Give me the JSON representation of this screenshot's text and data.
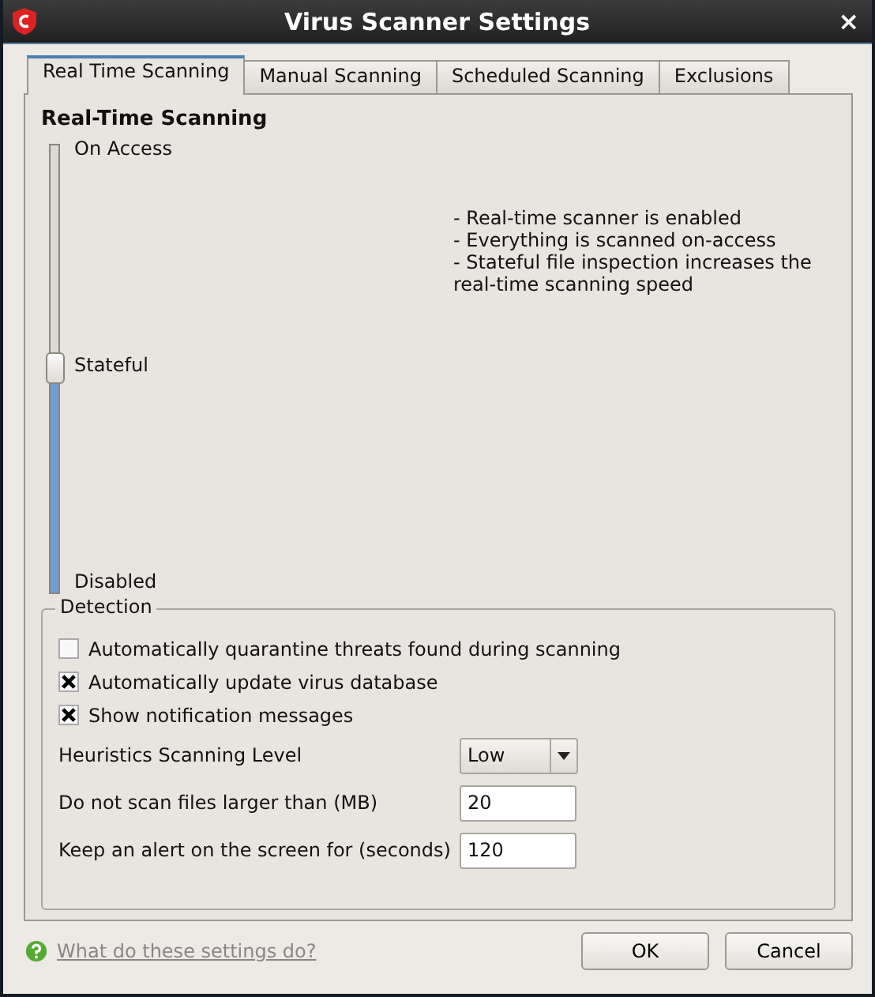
{
  "window": {
    "title": "Virus Scanner Settings",
    "close": "×"
  },
  "tabs": [
    {
      "label": "Real Time Scanning",
      "selected": true
    },
    {
      "label": "Manual Scanning",
      "selected": false
    },
    {
      "label": "Scheduled Scanning",
      "selected": false
    },
    {
      "label": "Exclusions",
      "selected": false
    }
  ],
  "section_title": "Real-Time Scanning",
  "slider": {
    "level": 0.5,
    "labels": [
      "On Access",
      "Stateful",
      "Disabled"
    ]
  },
  "description": [
    "- Real-time scanner is enabled",
    "- Everything is scanned on-access",
    "- Stateful file inspection increases the real-time scanning speed"
  ],
  "detection": {
    "title": "Detection",
    "checkboxes": [
      {
        "label": "Automatically quarantine threats found during scanning",
        "checked": false
      },
      {
        "label": "Automatically update virus database",
        "checked": true
      },
      {
        "label": "Show notification messages",
        "checked": true
      }
    ],
    "fields": [
      {
        "kind": "dropdown",
        "label": "Heuristics Scanning Level",
        "value": "Low"
      },
      {
        "kind": "input",
        "label": "Do not scan files larger than (MB)",
        "value": "20"
      },
      {
        "kind": "input",
        "label": "Keep an alert on the screen for (seconds)",
        "value": "120"
      }
    ]
  },
  "help_link": "What do these settings do?",
  "buttons": [
    "OK",
    "Cancel"
  ]
}
